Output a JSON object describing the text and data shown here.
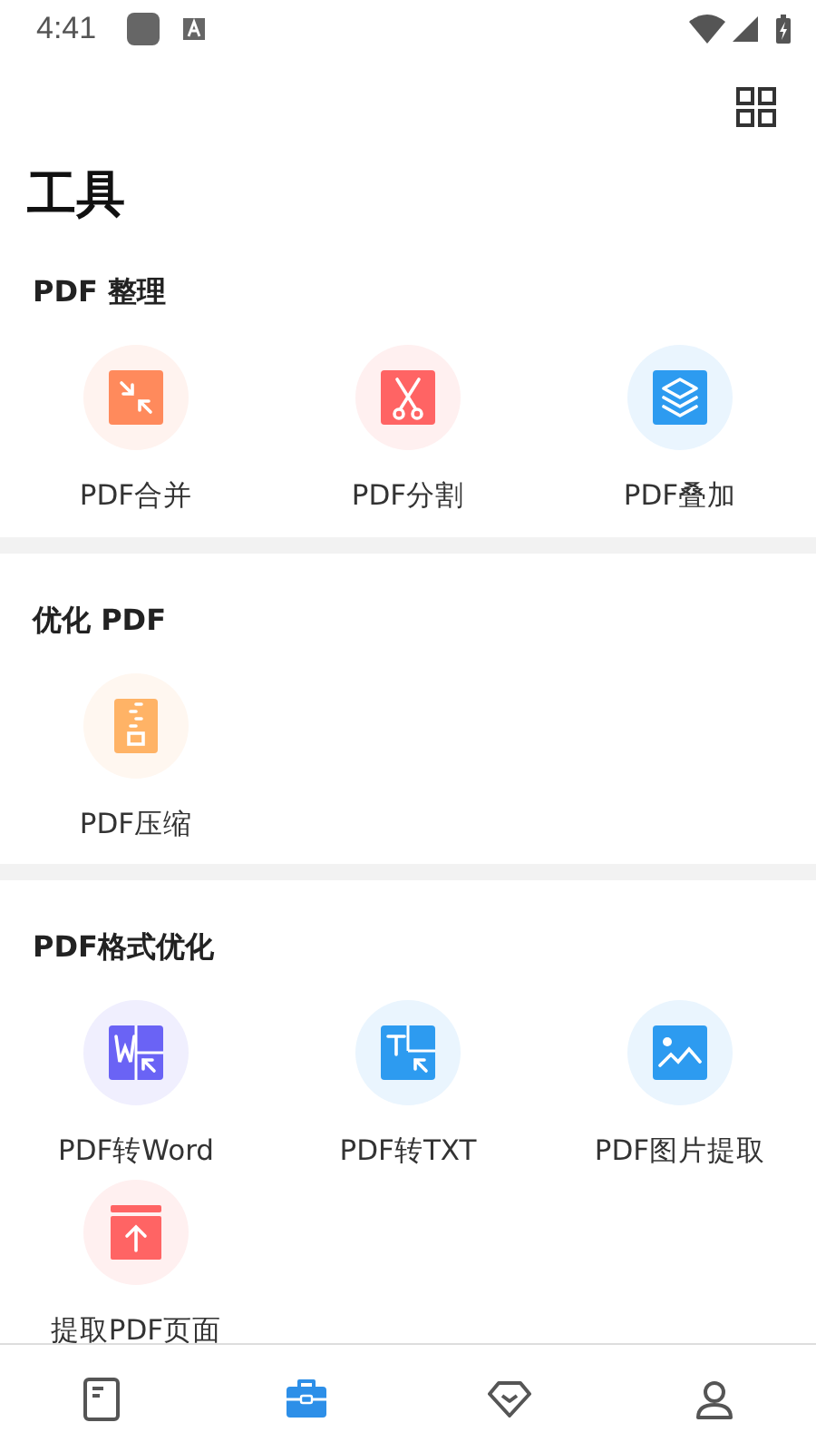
{
  "status_bar": {
    "time": "4:41"
  },
  "title": "工具",
  "sections": [
    {
      "title": "PDF 整理",
      "tools": [
        {
          "label": "PDF合并",
          "kind": "merge",
          "color": "#ff8a5c"
        },
        {
          "label": "PDF分割",
          "kind": "split",
          "color": "#ff6464"
        },
        {
          "label": "PDF叠加",
          "kind": "layers",
          "color": "#2d9bf0"
        }
      ]
    },
    {
      "title": "优化 PDF",
      "tools": [
        {
          "label": "PDF压缩",
          "kind": "zip",
          "color": "#ffb366"
        }
      ]
    },
    {
      "title": "PDF格式优化",
      "tools": [
        {
          "label": "PDF转Word",
          "kind": "word",
          "color": "#6a63f5"
        },
        {
          "label": "PDF转TXT",
          "kind": "txt",
          "color": "#2d9bf0"
        },
        {
          "label": "PDF图片提取",
          "kind": "image",
          "color": "#2d9bf0"
        },
        {
          "label": "提取PDF页面",
          "kind": "extract",
          "color": "#ff6464"
        }
      ]
    }
  ],
  "nav": [
    {
      "kind": "document",
      "selected": false
    },
    {
      "kind": "toolbox",
      "selected": true
    },
    {
      "kind": "diamond",
      "selected": false
    },
    {
      "kind": "person",
      "selected": false
    }
  ]
}
